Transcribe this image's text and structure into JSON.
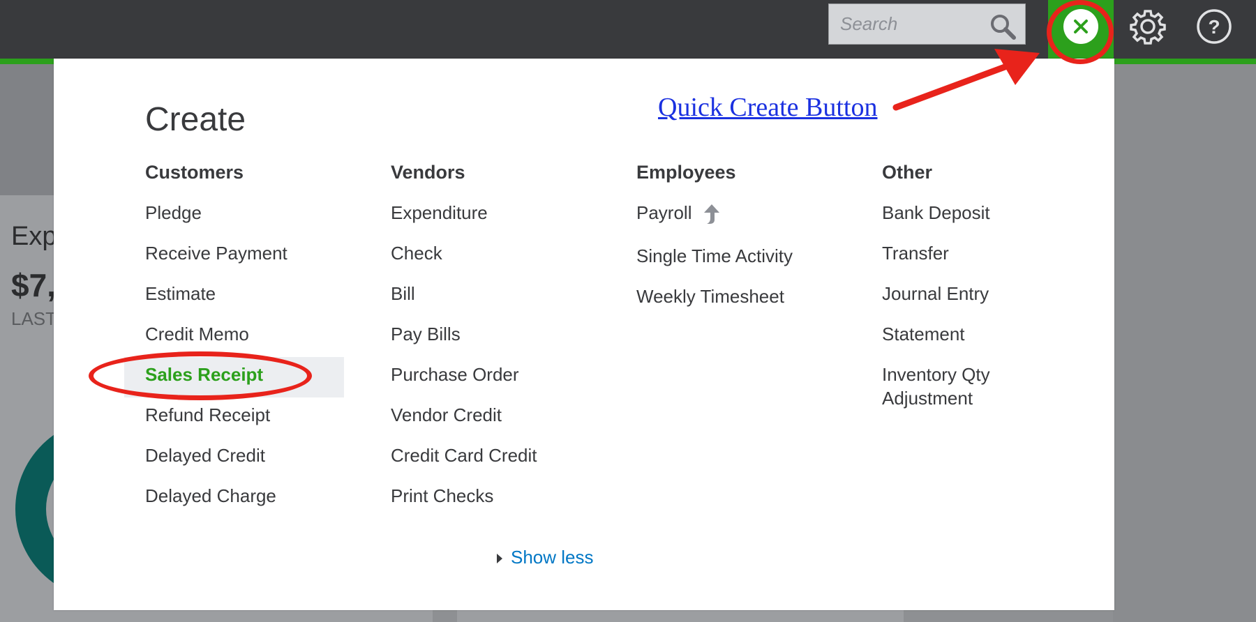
{
  "topbar": {
    "search_placeholder": "Search",
    "icons": {
      "search": "search-icon",
      "close": "close-icon",
      "settings": "gear-icon",
      "help": "help-icon"
    }
  },
  "background": {
    "card_title": "Exp",
    "card_amount": "$7,",
    "card_period": "LAST"
  },
  "create_panel": {
    "title": "Create",
    "columns": [
      {
        "heading": "Customers",
        "items": [
          "Pledge",
          "Receive Payment",
          "Estimate",
          "Credit Memo",
          "Sales Receipt",
          "Refund Receipt",
          "Delayed Credit",
          "Delayed Charge"
        ]
      },
      {
        "heading": "Vendors",
        "items": [
          "Expenditure",
          "Check",
          "Bill",
          "Pay Bills",
          "Purchase Order",
          "Vendor Credit",
          "Credit Card Credit",
          "Print Checks"
        ]
      },
      {
        "heading": "Employees",
        "items": [
          "Payroll",
          "Single Time Activity",
          "Weekly Timesheet"
        ]
      },
      {
        "heading": "Other",
        "items": [
          "Bank Deposit",
          "Transfer",
          "Journal Entry",
          "Statement",
          "Inventory Qty",
          "Adjustment"
        ]
      }
    ],
    "highlighted_item": "Sales Receipt",
    "show_less": "Show less"
  },
  "annotation": {
    "label": "Quick Create Button",
    "color": "#e8231b",
    "link_color": "#1a30e0"
  },
  "colors": {
    "brand_green": "#2ca01c",
    "topbar": "#393a3d",
    "link_blue": "#0077c5"
  }
}
